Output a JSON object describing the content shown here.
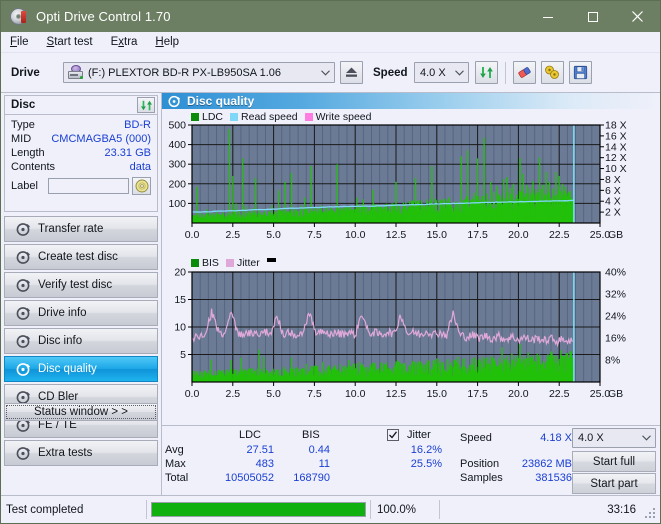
{
  "window": {
    "title": "Opti Drive Control 1.70",
    "icon": "disc-icon",
    "minimize": "minimize-button",
    "maximize": "maximize-button",
    "close": "close-button"
  },
  "menu": {
    "items": [
      {
        "label": "File",
        "accel": "F"
      },
      {
        "label": "Start test",
        "accel": "S"
      },
      {
        "label": "Extra",
        "accel": "x"
      },
      {
        "label": "Help",
        "accel": "H"
      }
    ]
  },
  "toolbar": {
    "drive_label": "Drive",
    "drive_value": "(F:)  PLEXTOR BD-R  PX-LB950SA 1.06",
    "eject_icon": "eject-icon",
    "speed_label": "Speed",
    "speed_value": "4.0 X",
    "refresh_icon": "refresh-icon",
    "eraser_icon": "eraser-icon",
    "bookmark_icon": "gold-disc-icon",
    "save_icon": "save-floppy-icon"
  },
  "disc_panel": {
    "title": "Disc",
    "refresh_icon": "refresh-icon",
    "rows": [
      {
        "key": "Type",
        "value": "BD-R"
      },
      {
        "key": "MID",
        "value": "CMCMAGBA5 (000)"
      },
      {
        "key": "Length",
        "value": "23.31 GB"
      },
      {
        "key": "Contents",
        "value": "data"
      }
    ],
    "label_key": "Label",
    "label_value": "",
    "label_button_icon": "cd-disc-icon"
  },
  "nav": {
    "items": [
      {
        "label": "Transfer rate",
        "icon": "disc-icon",
        "selected": false
      },
      {
        "label": "Create test disc",
        "icon": "disc-icon",
        "selected": false
      },
      {
        "label": "Verify test disc",
        "icon": "disc-icon",
        "selected": false
      },
      {
        "label": "Drive info",
        "icon": "disc-icon",
        "selected": false
      },
      {
        "label": "Disc info",
        "icon": "disc-icon",
        "selected": false
      },
      {
        "label": "Disc quality",
        "icon": "disc-icon",
        "selected": true
      },
      {
        "label": "CD Bler",
        "icon": "disc-icon",
        "selected": false
      },
      {
        "label": "FE / TE",
        "icon": "disc-icon",
        "selected": false
      },
      {
        "label": "Extra tests",
        "icon": "disc-icon",
        "selected": false
      }
    ],
    "status_window": "Status window > >"
  },
  "main": {
    "header": "Disc quality",
    "header_icon": "disc-quality-icon"
  },
  "stats": {
    "col_ldc": "LDC",
    "col_bis": "BIS",
    "jitter_label": "Jitter",
    "jitter_checked": true,
    "rows": [
      {
        "key": "Avg",
        "ldc": "27.51",
        "bis": "0.44",
        "jitter": "16.2%"
      },
      {
        "key": "Max",
        "ldc": "483",
        "bis": "11",
        "jitter": "25.5%"
      },
      {
        "key": "Total",
        "ldc": "10505052",
        "bis": "168790",
        "jitter": ""
      }
    ],
    "speed_key": "Speed",
    "speed_value": "4.18 X",
    "position_key": "Position",
    "position_value": "23862 MB",
    "samples_key": "Samples",
    "samples_value": "381536",
    "speed_select": "4.0 X",
    "start_full": "Start full",
    "start_part": "Start part"
  },
  "statusbar": {
    "message": "Test completed",
    "progress_pct": "100.0%",
    "progress_value": 100,
    "elapsed": "33:16"
  },
  "colors": {
    "titlebar": "#6d7f63",
    "accent": "#1a3fd4",
    "plot_bg": "#6b7b96",
    "ldc_green": "#22c00a",
    "bis_green": "#22c00a",
    "read_speed": "#7fd8f7",
    "write_speed": "#ff7de0",
    "jitter_pink": "#e0a8d8",
    "progress_green": "#10b010",
    "selected_nav": "#1ea8e8"
  },
  "chart_data": [
    {
      "type": "line",
      "id": "ldc-chart",
      "title": "",
      "xlabel": "GB",
      "ylabel": "LDC",
      "xlim": [
        0,
        25
      ],
      "ylim": [
        0,
        500
      ],
      "y2lim": [
        0,
        18
      ],
      "y2label": "X",
      "xticks": [
        "0.0",
        "2.5",
        "5.0",
        "7.5",
        "10.0",
        "12.5",
        "15.0",
        "17.5",
        "20.0",
        "22.5",
        "25.0"
      ],
      "yticks": [
        100,
        200,
        300,
        400,
        500
      ],
      "y2ticks": [
        "2 X",
        "4 X",
        "6 X",
        "8 X",
        "10 X",
        "12 X",
        "14 X",
        "16 X",
        "18 X"
      ],
      "grid": true,
      "legend": [
        {
          "name": "LDC",
          "color": "#0a8c0a"
        },
        {
          "name": "Read speed",
          "color": "#7fd8f7"
        },
        {
          "name": "Write speed",
          "color": "#ff7de0"
        }
      ],
      "series": [
        {
          "name": "LDC",
          "color": "#22c00a",
          "kind": "impulse",
          "x": [
            0.1,
            0.3,
            0.5,
            0.7,
            0.9,
            1.1,
            1.3,
            1.5,
            1.7,
            1.9,
            2.1,
            2.3,
            2.5,
            2.6,
            2.7,
            2.9,
            3.1,
            3.3,
            3.5,
            3.7,
            3.9,
            4.1,
            4.3,
            4.5,
            4.7,
            4.9,
            5.1,
            5.3,
            5.5,
            5.7,
            5.9,
            6.1,
            6.3,
            6.5,
            6.7,
            6.9,
            7.1,
            7.3,
            7.5,
            7.7,
            7.9,
            8.1,
            8.3,
            8.5,
            8.7,
            8.9,
            9.1,
            9.3,
            9.5,
            9.7,
            9.9,
            10.1,
            10.3,
            10.5,
            10.7,
            10.9,
            11.1,
            11.3,
            11.5,
            11.7,
            11.9,
            12.1,
            12.3,
            12.5,
            12.7,
            12.9,
            13.1,
            13.3,
            13.5,
            13.7,
            13.9,
            14.1,
            14.3,
            14.5,
            14.7,
            14.9,
            15.1,
            15.3,
            15.5,
            15.7,
            15.9,
            16.1,
            16.3,
            16.5,
            16.7,
            16.9,
            17.1,
            17.3,
            17.5,
            17.7,
            17.9,
            18.1,
            18.3,
            18.5,
            18.7,
            18.9,
            19.1,
            19.3,
            19.5,
            19.7,
            19.9,
            20.1,
            20.3,
            20.5,
            20.7,
            20.9,
            21.1,
            21.3,
            21.5,
            21.7,
            21.9,
            22.1,
            22.3,
            22.5,
            22.7,
            22.9,
            23.1,
            23.3
          ],
          "y": [
            40,
            185,
            60,
            45,
            70,
            55,
            50,
            60,
            45,
            55,
            50,
            480,
            240,
            70,
            100,
            65,
            330,
            85,
            60,
            75,
            230,
            65,
            55,
            70,
            60,
            90,
            55,
            165,
            70,
            210,
            60,
            255,
            70,
            60,
            90,
            130,
            75,
            290,
            80,
            60,
            90,
            60,
            80,
            55,
            65,
            300,
            75,
            60,
            70,
            85,
            70,
            130,
            60,
            120,
            75,
            65,
            170,
            60,
            80,
            70,
            60,
            75,
            90,
            210,
            70,
            65,
            105,
            80,
            60,
            230,
            75,
            60,
            85,
            65,
            290,
            70,
            60,
            120,
            75,
            65,
            90,
            60,
            75,
            340,
            120,
            370,
            80,
            155,
            330,
            120,
            435,
            150,
            210,
            160,
            190,
            130,
            225,
            235,
            180,
            200,
            145,
            330,
            250,
            195,
            180,
            215,
            160,
            335,
            195,
            260,
            210,
            175,
            260,
            240,
            200,
            185,
            160,
            120
          ]
        },
        {
          "name": "Read speed",
          "color": "#7fd8f7",
          "kind": "line",
          "x": [
            0.0,
            1.2,
            2.0,
            3.0,
            4.0,
            5.0,
            6.0,
            7.0,
            8.0,
            9.0,
            10.0,
            11.0,
            12.0,
            13.0,
            14.0,
            15.0,
            16.0,
            17.0,
            18.0,
            19.0,
            20.0,
            21.0,
            22.0,
            23.0,
            23.4
          ],
          "y": [
            2.0,
            2.1,
            2.2,
            2.3,
            2.45,
            2.55,
            2.7,
            2.8,
            2.9,
            3.0,
            3.05,
            3.1,
            3.2,
            3.3,
            3.4,
            3.5,
            3.6,
            3.65,
            3.75,
            3.85,
            3.9,
            3.95,
            4.05,
            4.1,
            4.15
          ]
        }
      ],
      "cursor_x": 23.4
    },
    {
      "type": "line",
      "id": "bis-chart",
      "title": "",
      "xlabel": "GB",
      "ylabel": "BIS",
      "xlim": [
        0,
        25
      ],
      "ylim": [
        0,
        20
      ],
      "y2lim": [
        0,
        40
      ],
      "y2label": "%",
      "xticks": [
        "0.0",
        "2.5",
        "5.0",
        "7.5",
        "10.0",
        "12.5",
        "15.0",
        "17.5",
        "20.0",
        "22.5",
        "25.0"
      ],
      "yticks": [
        5,
        10,
        15,
        20
      ],
      "y2ticks": [
        "8%",
        "16%",
        "24%",
        "32%",
        "40%"
      ],
      "grid": true,
      "legend": [
        {
          "name": "BIS",
          "color": "#0a8c0a"
        },
        {
          "name": "Jitter",
          "color": "#e0a8d8"
        }
      ],
      "series": [
        {
          "name": "BIS",
          "color": "#22c00a",
          "kind": "impulse",
          "base": 1.8,
          "spikes": [
            {
              "x": 1.15,
              "y": 4.1
            },
            {
              "x": 2.4,
              "y": 4.0
            },
            {
              "x": 3.0,
              "y": 4.4
            },
            {
              "x": 4.1,
              "y": 5.9
            },
            {
              "x": 4.4,
              "y": 4.6
            },
            {
              "x": 6.1,
              "y": 4.4
            },
            {
              "x": 7.0,
              "y": 3.3
            },
            {
              "x": 8.0,
              "y": 3.6
            },
            {
              "x": 9.6,
              "y": 4.0
            },
            {
              "x": 10.3,
              "y": 3.6
            },
            {
              "x": 11.2,
              "y": 3.4
            },
            {
              "x": 12.6,
              "y": 4.0
            },
            {
              "x": 13.5,
              "y": 3.8
            },
            {
              "x": 15.0,
              "y": 4.3
            },
            {
              "x": 16.3,
              "y": 4.6
            },
            {
              "x": 17.4,
              "y": 4.0
            },
            {
              "x": 18.5,
              "y": 4.4
            },
            {
              "x": 19.0,
              "y": 6.3
            },
            {
              "x": 19.6,
              "y": 5.2
            },
            {
              "x": 20.1,
              "y": 6.9
            },
            {
              "x": 20.6,
              "y": 5.4
            },
            {
              "x": 21.3,
              "y": 5.0
            },
            {
              "x": 22.0,
              "y": 5.6
            },
            {
              "x": 22.6,
              "y": 5.8
            },
            {
              "x": 23.0,
              "y": 5.2
            }
          ]
        },
        {
          "name": "Jitter",
          "color": "#e0a8d8",
          "kind": "line",
          "mean": 8.6,
          "x": [
            0.0,
            0.4,
            0.8,
            1.2,
            1.6,
            2.0,
            2.4,
            2.8,
            3.2,
            3.6,
            4.0,
            4.4,
            4.8,
            5.2,
            5.6,
            6.0,
            6.4,
            6.8,
            7.2,
            7.6,
            8.0,
            8.4,
            8.8,
            9.2,
            9.6,
            10.0,
            10.4,
            10.8,
            11.2,
            11.6,
            12.0,
            12.4,
            12.8,
            13.2,
            13.6,
            14.0,
            14.4,
            14.8,
            15.2,
            15.6,
            16.0,
            16.4,
            16.8,
            17.2,
            17.6,
            18.0,
            18.4,
            18.8,
            19.2,
            19.6,
            20.0,
            20.4,
            20.8,
            21.2,
            21.6,
            22.0,
            22.4,
            22.8,
            23.3
          ],
          "y": [
            7.6,
            8.4,
            8.9,
            12.7,
            9.3,
            8.3,
            12.5,
            9.0,
            8.6,
            9.0,
            8.4,
            9.3,
            8.8,
            11.9,
            8.7,
            9.0,
            8.4,
            9.2,
            12.4,
            8.8,
            9.2,
            8.6,
            9.0,
            8.7,
            9.1,
            8.5,
            12.6,
            8.9,
            9.0,
            8.5,
            9.2,
            8.7,
            12.3,
            8.8,
            9.0,
            8.6,
            9.3,
            8.7,
            9.0,
            8.5,
            12.5,
            8.6,
            8.2,
            8.5,
            8.0,
            8.4,
            7.9,
            8.3,
            7.8,
            8.2,
            7.7,
            8.1,
            7.6,
            8.0,
            7.5,
            7.9,
            7.4,
            7.8,
            7.3
          ]
        }
      ],
      "cursor_x": 23.4
    }
  ]
}
